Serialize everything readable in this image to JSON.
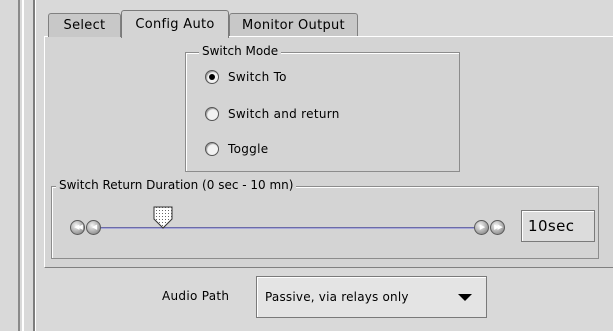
{
  "tabs": [
    {
      "label": "Select",
      "active": false
    },
    {
      "label": "Config Auto",
      "active": true
    },
    {
      "label": "Monitor Output",
      "active": false
    }
  ],
  "switch_mode": {
    "title": "Switch Mode",
    "options": [
      {
        "label": "Switch To",
        "selected": true
      },
      {
        "label": "Switch and return",
        "selected": false
      },
      {
        "label": "Toggle",
        "selected": false
      }
    ]
  },
  "switch_return": {
    "title": "Switch Return Duration (0 sec - 10 mn)",
    "value_text": "10sec",
    "slider_position_fraction": 0.15
  },
  "audio_path": {
    "label": "Audio Path",
    "selected": "Passive, via relays only"
  },
  "colors": {
    "slider_track": "#6b6ba8",
    "panel_bg": "#d4d4d4"
  },
  "icons": {
    "ff_left": "double-left-arrow-icon",
    "left": "left-arrow-icon",
    "right": "right-arrow-icon",
    "ff_right": "double-right-arrow-icon",
    "thumb": "slider-thumb-icon",
    "dropdown": "dropdown-caret-icon"
  }
}
